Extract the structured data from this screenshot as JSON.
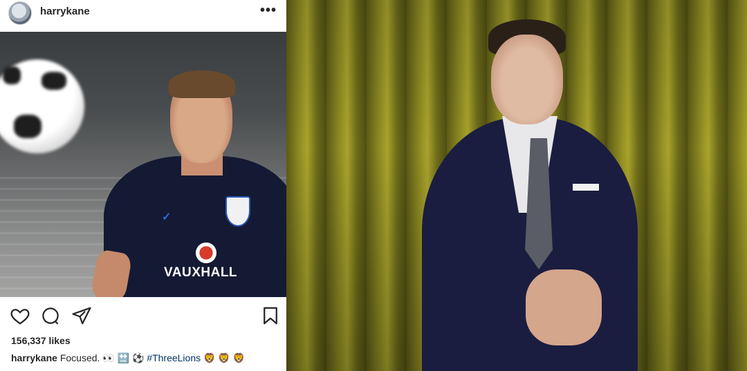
{
  "post": {
    "username": "harrykane",
    "more_label": "•••",
    "photo": {
      "sponsor_text": "VAUXHALL"
    },
    "likes": "156,337 likes",
    "caption": {
      "user": "harrykane",
      "text": " Focused. 👀 🔛 ⚽ ",
      "hashtag": "#ThreeLions",
      "emoji_tail": " 🦁 🦁 🦁"
    },
    "icons": [
      "heart-icon",
      "comment-icon",
      "share-icon",
      "bookmark-icon"
    ]
  },
  "portrait": {
    "background_color": "#8d8a22",
    "suit_color": "#1a1d3f"
  }
}
